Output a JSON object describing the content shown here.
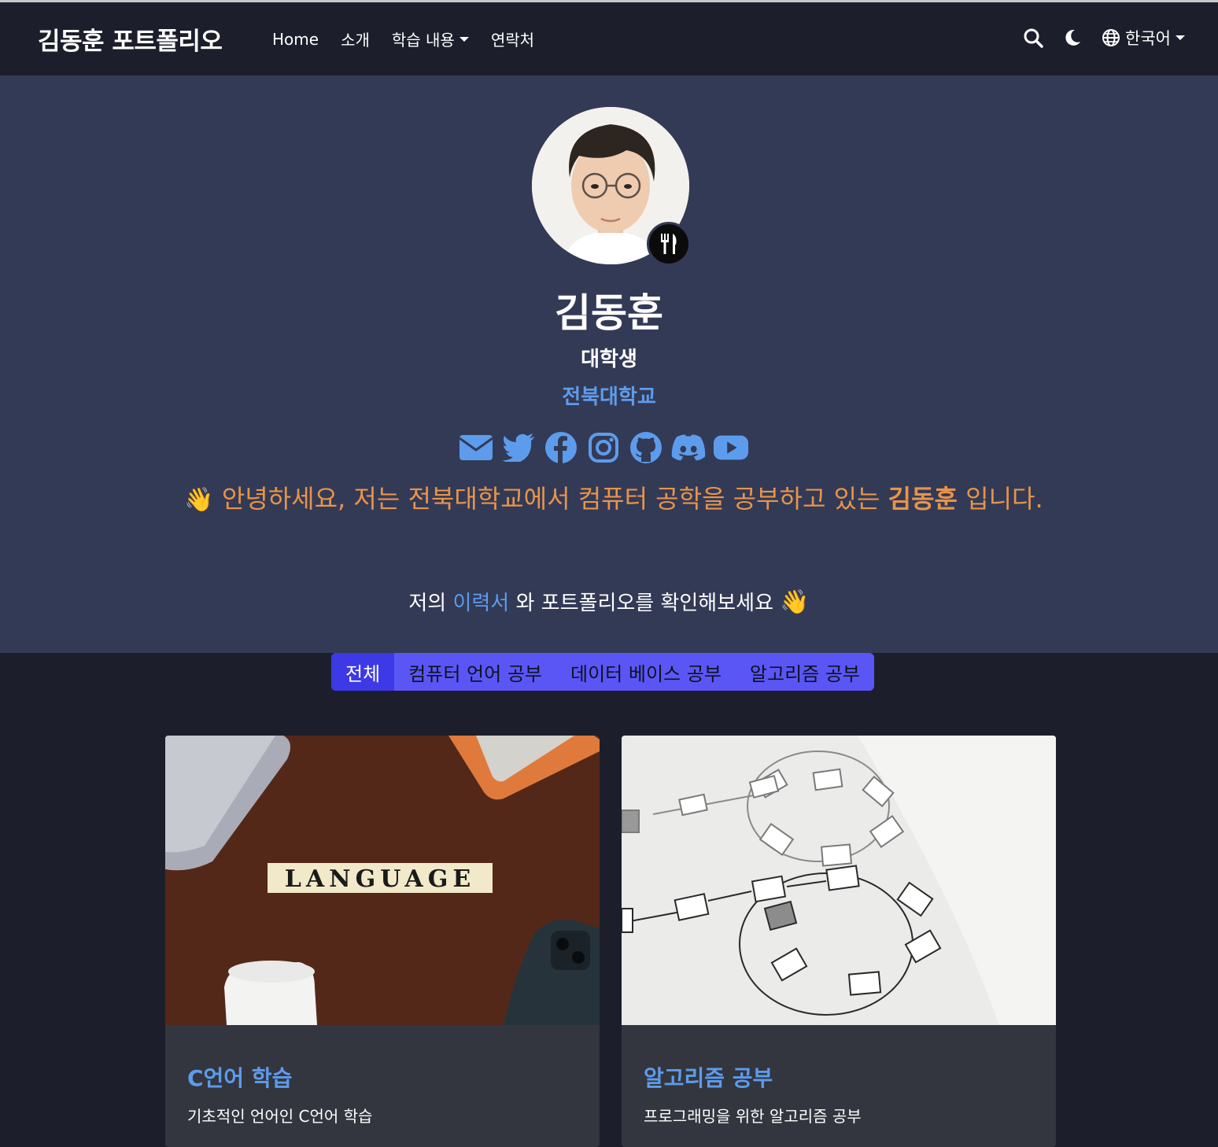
{
  "navbar": {
    "brand": "김동훈 포트폴리오",
    "links": [
      "Home",
      "소개",
      "학습 내용",
      "연락처"
    ],
    "language": "한국어"
  },
  "profile": {
    "name": "김동훈",
    "role": "대학생",
    "organization": "전북대학교",
    "status_icon": "utensils-icon",
    "socials": [
      "email-icon",
      "twitter-icon",
      "facebook-icon",
      "instagram-icon",
      "github-icon",
      "discord-icon",
      "youtube-icon"
    ]
  },
  "intro": {
    "wave": "👋",
    "before": "안녕하세요, 저는 전북대학교에서 컴퓨터 공학을 공부하고 있는",
    "name": "김동훈",
    "after": "입니다."
  },
  "cta": {
    "prefix": "저의",
    "link": "이력서",
    "suffix": "와 포트폴리오를 확인해보세요",
    "wave": "👋"
  },
  "tabs": [
    "전체",
    "컴퓨터 언어 공부",
    "데이터 베이스 공부",
    "알고리즘 공부"
  ],
  "cards": [
    {
      "title": "C언어 학습",
      "desc": "기초적인 언어인 C언어 학습",
      "image_text": "LANGUAGE"
    },
    {
      "title": "알고리즘 공부",
      "desc": "프로그래밍을 위한 알고리즘 공부"
    }
  ],
  "colors": {
    "nav_bg": "#1c1f2b",
    "hero_bg": "#333a56",
    "accent": "#5d9cec",
    "intro": "#e8944a",
    "tabs": "#5a56f5",
    "tab_active": "#3d39e6"
  }
}
